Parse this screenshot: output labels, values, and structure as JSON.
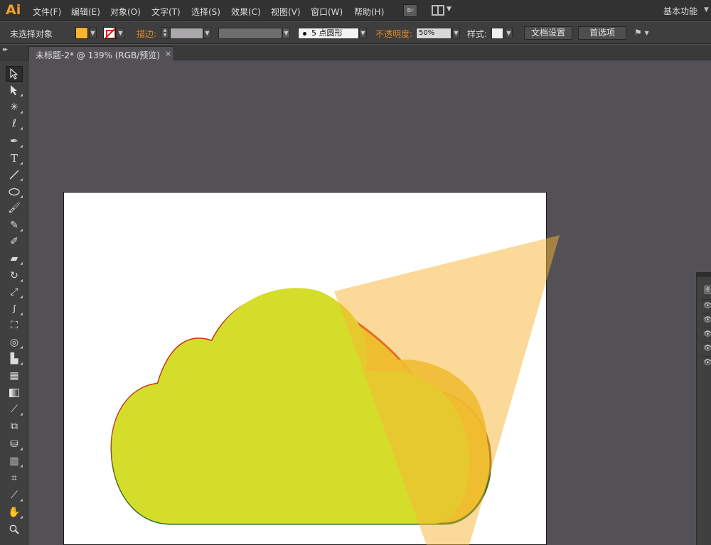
{
  "app": {
    "logo": "Ai"
  },
  "menu": [
    {
      "label": "文件(F)",
      "name": "menu-file"
    },
    {
      "label": "编辑(E)",
      "name": "menu-edit"
    },
    {
      "label": "对象(O)",
      "name": "menu-object"
    },
    {
      "label": "文字(T)",
      "name": "menu-type"
    },
    {
      "label": "选择(S)",
      "name": "menu-select"
    },
    {
      "label": "效果(C)",
      "name": "menu-effect"
    },
    {
      "label": "视图(V)",
      "name": "menu-view"
    },
    {
      "label": "窗口(W)",
      "name": "menu-window"
    },
    {
      "label": "帮助(H)",
      "name": "menu-help"
    }
  ],
  "bridge_label": "Br",
  "workspace": {
    "label": "基本功能"
  },
  "control": {
    "selection_status": "未选择对象",
    "stroke_label": "描边:",
    "brush_size": "5",
    "brush_label": "点圆形",
    "opacity_label": "不透明度:",
    "opacity_value": "50%",
    "style_label": "样式:",
    "doc_setup_button": "文档设置",
    "preferences_button": "首选项",
    "fill_color": "#f8b332"
  },
  "document_tab": {
    "title": "未标题-2* @ 139% (RGB/预览)",
    "close": "×"
  },
  "tools": [
    "selection-tool",
    "direct-selection-tool",
    "magic-wand-tool",
    "lasso-tool",
    "pen-tool",
    "type-tool",
    "line-segment-tool",
    "ellipse-tool",
    "paintbrush-tool",
    "pencil-tool",
    "blob-brush-tool",
    "eraser-tool",
    "rotate-tool",
    "scale-tool",
    "warp-tool",
    "free-transform-tool",
    "shape-builder-tool",
    "perspective-grid-tool",
    "mesh-tool",
    "gradient-tool",
    "eyedropper-tool",
    "blend-tool",
    "symbol-sprayer-tool",
    "column-graph-tool",
    "artboard-tool",
    "slice-tool",
    "hand-tool",
    "zoom-tool"
  ],
  "right_panel": {
    "header_icon": "图"
  },
  "artwork": {
    "cloud_fill": "#d4de2a",
    "cloud_outline_top": "#d0201a",
    "cloud_outline_bottom": "#1a6e2a",
    "shadow_fill": "#f8b332",
    "shadow_opacity": 0.5
  }
}
